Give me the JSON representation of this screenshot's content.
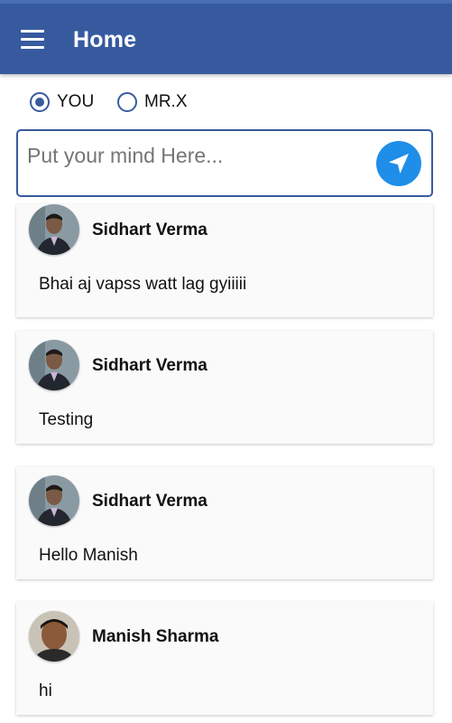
{
  "appbar": {
    "title": "Home",
    "menu_icon": "hamburger-menu-icon",
    "color": "#375a9f"
  },
  "audience": {
    "options": [
      {
        "label": "YOU",
        "selected": true
      },
      {
        "label": "MR.X",
        "selected": false
      }
    ]
  },
  "composer": {
    "placeholder": "Put your mind Here...",
    "value": "",
    "send_icon": "send-arrow-icon",
    "send_color": "#1e8ee9"
  },
  "posts": [
    {
      "author": "Sidhart Verma",
      "message": "Bhai aj vapss watt lag gyiiiii",
      "avatar": "person-photo-icon"
    },
    {
      "author": "Sidhart Verma",
      "message": "Testing",
      "avatar": "person-photo-icon"
    },
    {
      "author": "Sidhart Verma",
      "message": "Hello Manish",
      "avatar": "person-photo-icon"
    },
    {
      "author": "Manish Sharma",
      "message": "hi",
      "avatar": "person-photo-icon"
    }
  ]
}
